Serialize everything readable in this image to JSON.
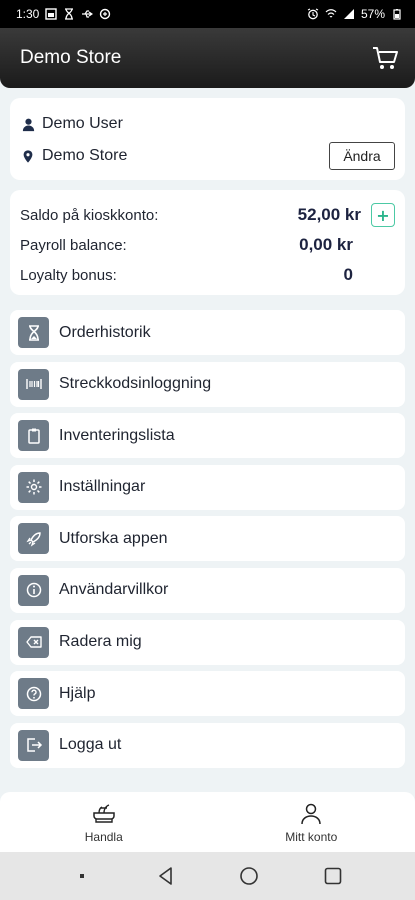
{
  "status_bar": {
    "time": "1:30",
    "battery": "57%"
  },
  "header": {
    "title": "Demo Store",
    "cart_icon": "cart-icon"
  },
  "user": {
    "name": "Demo User",
    "store": "Demo Store",
    "change_label": "Ändra"
  },
  "balances": [
    {
      "label": "Saldo på kioskkonto:",
      "value": "52,00 kr"
    },
    {
      "label": "Payroll balance:",
      "value": "0,00 kr"
    },
    {
      "label": "Loyalty bonus:",
      "value": "0"
    }
  ],
  "add_label": "+",
  "menu": [
    {
      "label": "Orderhistorik",
      "icon": "hourglass-icon"
    },
    {
      "label": "Streckkodsinloggning",
      "icon": "barcode-icon"
    },
    {
      "label": "Inventeringslista",
      "icon": "clipboard-icon"
    },
    {
      "label": "Inställningar",
      "icon": "gear-icon"
    },
    {
      "label": "Utforska appen",
      "icon": "rocket-icon"
    },
    {
      "label": "Användarvillkor",
      "icon": "info-icon"
    },
    {
      "label": "Radera mig",
      "icon": "delete-icon"
    },
    {
      "label": "Hjälp",
      "icon": "help-icon"
    },
    {
      "label": "Logga ut",
      "icon": "logout-icon"
    }
  ],
  "bottom_nav": [
    {
      "label": "Handla",
      "icon": "shop-icon"
    },
    {
      "label": "Mitt konto",
      "icon": "user-icon"
    }
  ],
  "colors": {
    "header_bg": "#2a2a2a",
    "page_bg": "#eef3f5",
    "menu_icon_bg": "#6e7b88",
    "accent_green": "#2bb58c"
  }
}
